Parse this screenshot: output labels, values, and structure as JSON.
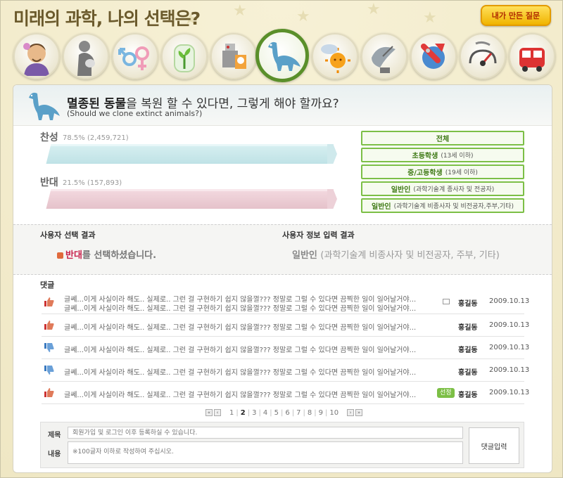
{
  "site": {
    "title": "미래의 과학, 나의 선택은?",
    "my_question_button": "내가 만든 질문"
  },
  "topics": [
    {
      "icon": "person-icon"
    },
    {
      "icon": "pregnant-woman-icon"
    },
    {
      "icon": "gender-symbols-icon"
    },
    {
      "icon": "plant-in-jar-icon"
    },
    {
      "icon": "robot-icon"
    },
    {
      "icon": "dinosaur-icon",
      "active": true
    },
    {
      "icon": "weather-sun-icon"
    },
    {
      "icon": "satellite-dish-icon"
    },
    {
      "icon": "rocket-icon"
    },
    {
      "icon": "gauge-icon"
    },
    {
      "icon": "train-icon"
    }
  ],
  "question": {
    "highlight": "멸종된 동물",
    "rest": "을 복원 할 수 있다면, 그렇게 해야 할까요?",
    "subtitle": "(Should we clone extinct animals?)"
  },
  "votes": {
    "agree": {
      "label": "찬성",
      "stat": "78.5% (2,459,721)",
      "percent": 78.5,
      "color": "#bfe2e6"
    },
    "disagree": {
      "label": "반대",
      "stat": "21.5% (157,893)",
      "percent": 21.5,
      "color": "#e5c2ca"
    }
  },
  "filters": [
    {
      "label": "전체",
      "sub": ""
    },
    {
      "label": "초등학생",
      "sub": "(13세 이하)"
    },
    {
      "label": "중/고등학생",
      "sub": "(19세 이하)"
    },
    {
      "label": "일반인",
      "sub": "(과학기술계 종사자 및 전공자)"
    },
    {
      "label": "일반인",
      "sub": "(과학기술계 비종사자 및 비전공자,주부,기타)"
    }
  ],
  "result": {
    "user_choice_heading": "사용자 선택 결과",
    "user_info_heading": "사용자 정보 입력 결과",
    "choice_highlight": "반대",
    "choice_rest": "를 선택하셨습니다.",
    "info_main": "일반인",
    "info_sub": "(과학기술계 비종사자 및 비전공자, 주부, 기타)"
  },
  "comments": {
    "title": "댓글",
    "rows": [
      {
        "vote": "up",
        "lines": [
          "글쎄...이게 사실이라 해도.. 실제로.. 그런 걸 구현하기 쉽지 않을껄??? 정말로 그럴 수 있다면 끔찍한 일이 일어날거야...",
          "글쎄...이게 사실이라 해도.. 실제로.. 그런 걸 구현하기 쉽지 않을껄??? 정말로 그럴 수 있다면 끔찍한 일이 일어날거야..."
        ],
        "author": "홍길동",
        "date": "2009.10.13",
        "mail": true,
        "selected": ""
      },
      {
        "vote": "up",
        "lines": [
          "글쎄...이게 사실이라 해도.. 실제로.. 그런 걸 구현하기 쉽지 않을껄??? 정말로 그럴 수 있다면 끔찍한 일이 일어날거야..."
        ],
        "author": "홍길동",
        "date": "2009.10.13",
        "mail": false,
        "selected": ""
      },
      {
        "vote": "down",
        "lines": [
          "글쎄...이게 사실이라 해도.. 실제로.. 그런 걸 구현하기 쉽지 않을껄??? 정말로 그럴 수 있다면 끔찍한 일이 일어날거야..."
        ],
        "author": "홍길동",
        "date": "2009.10.13",
        "mail": false,
        "selected": ""
      },
      {
        "vote": "down",
        "lines": [
          "글쎄...이게 사실이라 해도.. 실제로.. 그런 걸 구현하기 쉽지 않을껄??? 정말로 그럴 수 있다면 끔찍한 일이 일어날거야..."
        ],
        "author": "홍길동",
        "date": "2009.10.13",
        "mail": false,
        "selected": ""
      },
      {
        "vote": "up",
        "lines": [
          "글쎄...이게 사실이라 해도.. 실제로.. 그런 걸 구현하기 쉽지 않을껄??? 정말로 그럴 수 있다면 끔찍한 일이 일어날거야..."
        ],
        "author": "홍길동",
        "date": "2009.10.13",
        "mail": false,
        "selected": "선정"
      }
    ]
  },
  "pagination": {
    "pages": [
      "1",
      "2",
      "3",
      "4",
      "5",
      "6",
      "7",
      "8",
      "9",
      "10"
    ],
    "current": "2"
  },
  "form": {
    "title_label": "제목",
    "content_label": "내용",
    "title_placeholder": "회원가입 및 로그인 이후 등록하실 수 있습니다.",
    "content_placeholder": "※100글자 이하로 작성하여 주십시오.",
    "submit_label": "댓글입력"
  }
}
